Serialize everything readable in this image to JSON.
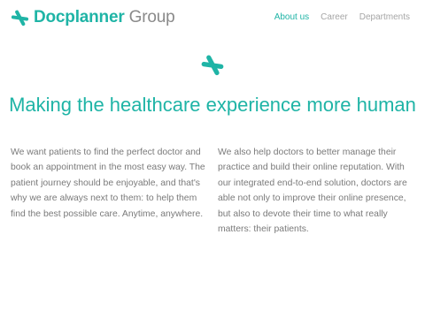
{
  "header": {
    "logo": {
      "brand": "Docplanner",
      "group": "Group",
      "icon": "docplanner-asterisk-icon",
      "brand_color": "#1fb4a6",
      "group_color": "#8a8a8a"
    },
    "nav": [
      {
        "label": "About us",
        "active": true
      },
      {
        "label": "Career",
        "active": false
      },
      {
        "label": "Departments",
        "active": false
      }
    ]
  },
  "hero": {
    "icon": "docplanner-asterisk-icon",
    "title": "Making the healthcare experience more human",
    "accent_color": "#1fb4a6"
  },
  "content": {
    "left": "We want patients to find the perfect doctor and book an appointment in the most easy way. The patient journey should be enjoyable, and that's why we are always next to them: to help them find the best possible care. Anytime, anywhere.",
    "right": "We also help doctors to better manage their practice and build their online reputation. With our integrated end-to-end solution, doctors are able not only to improve their online presence, but also to devote their time to what really matters: their patients."
  }
}
